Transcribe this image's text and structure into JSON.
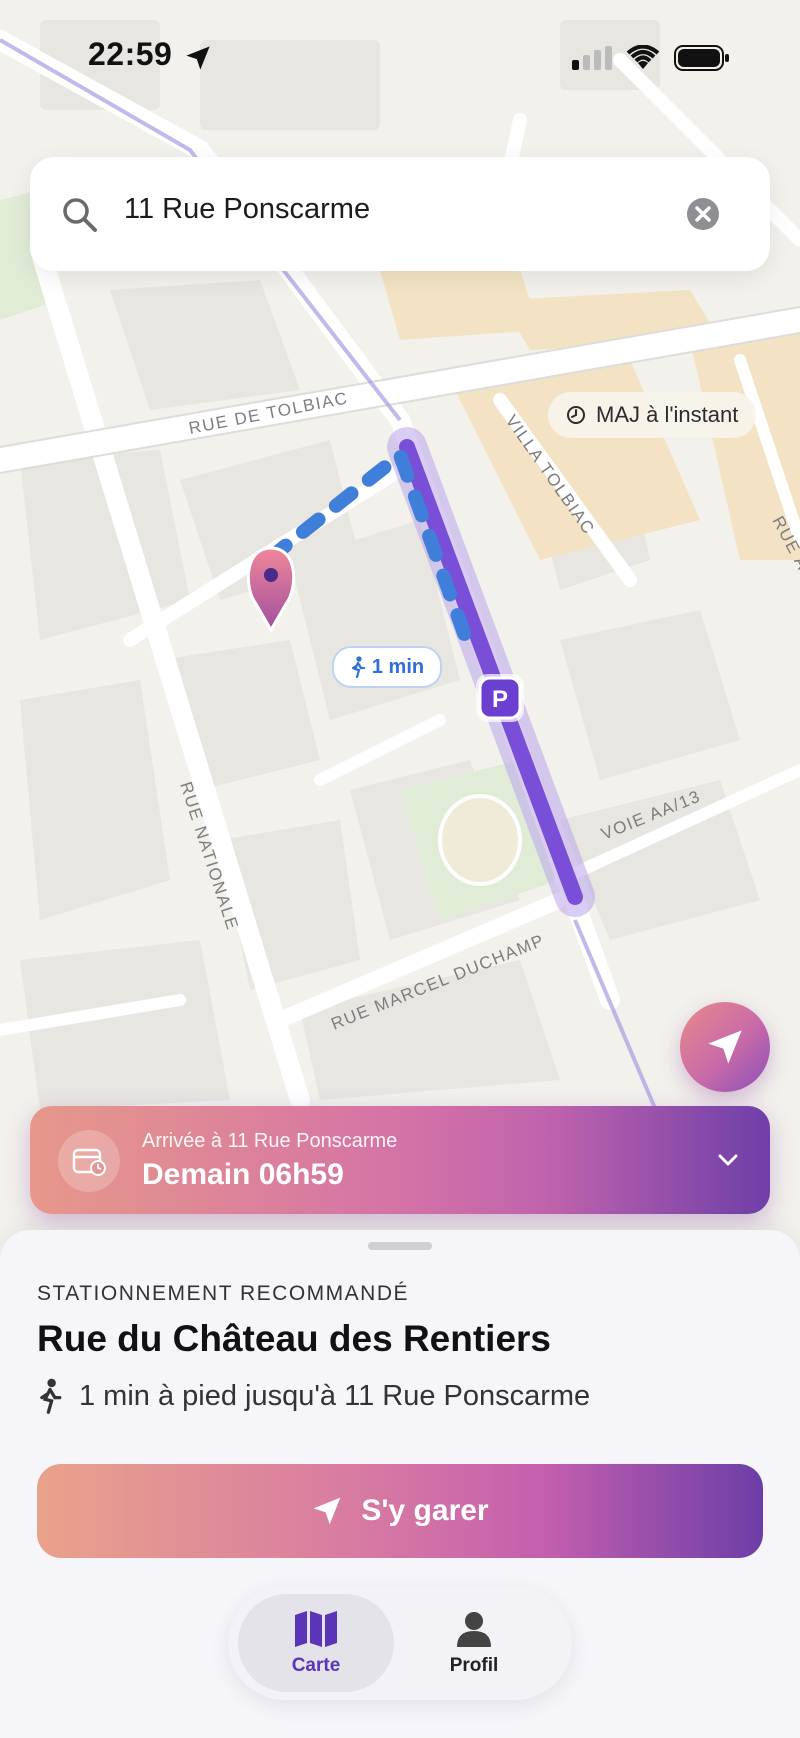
{
  "status_bar": {
    "time": "22:59"
  },
  "search": {
    "value": "11 Rue Ponscarme"
  },
  "map": {
    "update_badge": "MAJ à l'instant",
    "walk_badge": "1 min",
    "parking_marker": "P",
    "streets": [
      "RUE DE TOLBIAC",
      "VILLA TOLBIAC",
      "RUE A",
      "RUE NATIONALE",
      "VOIE AA/13",
      "RUE MARCEL DUCHAMP"
    ]
  },
  "arrival": {
    "label": "Arrivée à 11 Rue Ponscarme",
    "time": "Demain 06h59"
  },
  "sheet": {
    "overline": "STATIONNEMENT RECOMMANDÉ",
    "spot_name": "Rue du Château des Rentiers",
    "walk_text": "1 min à pied jusqu'à 11 Rue Ponscarme",
    "cta": "S'y garer"
  },
  "tabs": [
    {
      "label": "Carte"
    },
    {
      "label": "Profil"
    }
  ],
  "colors": {
    "accent": "#6c3ea7",
    "route": "#7a4fd8",
    "walk": "#3f7fd9"
  }
}
